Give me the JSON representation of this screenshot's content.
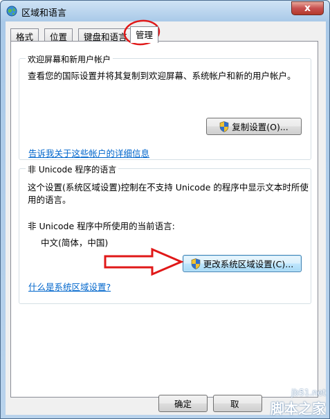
{
  "window": {
    "title": "区域和语言",
    "close_glyph": "x"
  },
  "tabs": [
    {
      "label": "格式"
    },
    {
      "label": "位置"
    },
    {
      "label": "键盘和语言"
    },
    {
      "label": "管理",
      "active": true
    }
  ],
  "welcome_group": {
    "title": "欢迎屏幕和新用户帐户",
    "description": "查看您的国际设置并将其复制到欢迎屏幕、系统帐户和新的用户帐户。",
    "copy_button": "复制设置(O)...",
    "details_link": "告诉我关于这些帐户的详细信息"
  },
  "unicode_group": {
    "title": "非 Unicode 程序的语言",
    "description_line1": "这个设置(系统区域设置)控制在不支持 Unicode 的程序中显示文本时所使",
    "description_line2": "用的语言。",
    "current_label": "非 Unicode 程序中所使用的当前语言:",
    "current_value": "中文(简体，中国)",
    "change_button": "更改系统区域设置(C)...",
    "help_link": "什么是系统区域设置?"
  },
  "footer": {
    "ok_button": "确定",
    "cancel_button": "取"
  },
  "watermark": {
    "url": "jb51.net",
    "name": "脚本之家"
  },
  "colors": {
    "link": "#0066cc",
    "annotation_red": "#e01818",
    "close_button": "#c75050"
  },
  "icons": {
    "title": "globe-icon",
    "button": "uac-shield-icon"
  }
}
